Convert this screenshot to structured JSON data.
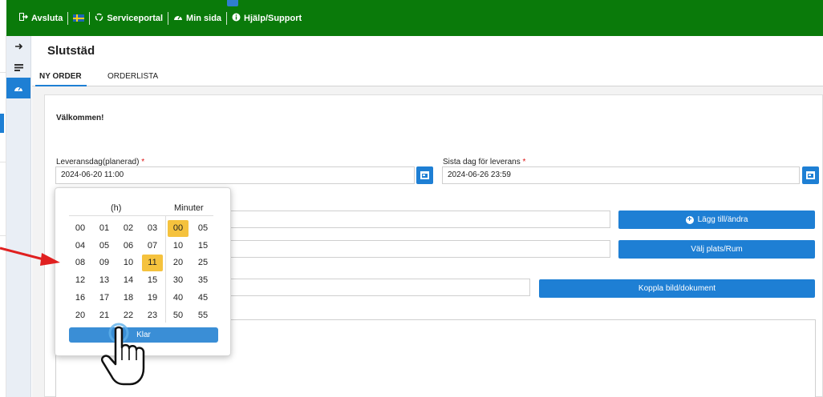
{
  "topbar": {
    "logout": "Avsluta",
    "serviceportal": "Serviceportal",
    "my_page": "Min sida",
    "help": "Hjälp/Support",
    "bg_color": "#0a7a0a"
  },
  "sidebar": {
    "items": [
      {
        "icon": "arrow-right-icon"
      },
      {
        "icon": "list-icon"
      },
      {
        "icon": "dashboard-icon",
        "active": true
      }
    ]
  },
  "page": {
    "title": "Slutstäd",
    "tabs": [
      {
        "label": "NY ORDER",
        "active": true
      },
      {
        "label": "ORDERLISTA",
        "active": false
      }
    ],
    "welcome": "Välkommen!"
  },
  "form": {
    "delivery_date_label": "Leveransdag(planerad)",
    "delivery_date_value": "2024-06-20 11:00",
    "last_date_label": "Sista dag för leverans",
    "last_date_value": "2024-06-26 23:59",
    "required_mark": "*",
    "add_change_button": "Lägg till/ändra",
    "choose_place_button": "Välj plats/Rum",
    "attach_button": "Koppla bild/dokument"
  },
  "time_picker": {
    "hours_header": "(h)",
    "minutes_header": "Minuter",
    "hours": [
      "00",
      "01",
      "02",
      "03",
      "04",
      "05",
      "06",
      "07",
      "08",
      "09",
      "10",
      "11",
      "12",
      "13",
      "14",
      "15",
      "16",
      "17",
      "18",
      "19",
      "20",
      "21",
      "22",
      "23"
    ],
    "minutes": [
      "00",
      "05",
      "10",
      "15",
      "20",
      "25",
      "30",
      "35",
      "40",
      "45",
      "50",
      "55"
    ],
    "selected_hour": "11",
    "selected_minute": "00",
    "done_button": "Klar",
    "highlight_color": "#f5c23d"
  },
  "colors": {
    "accent": "#1e7fd4",
    "annotation_arrow": "#e02020"
  }
}
